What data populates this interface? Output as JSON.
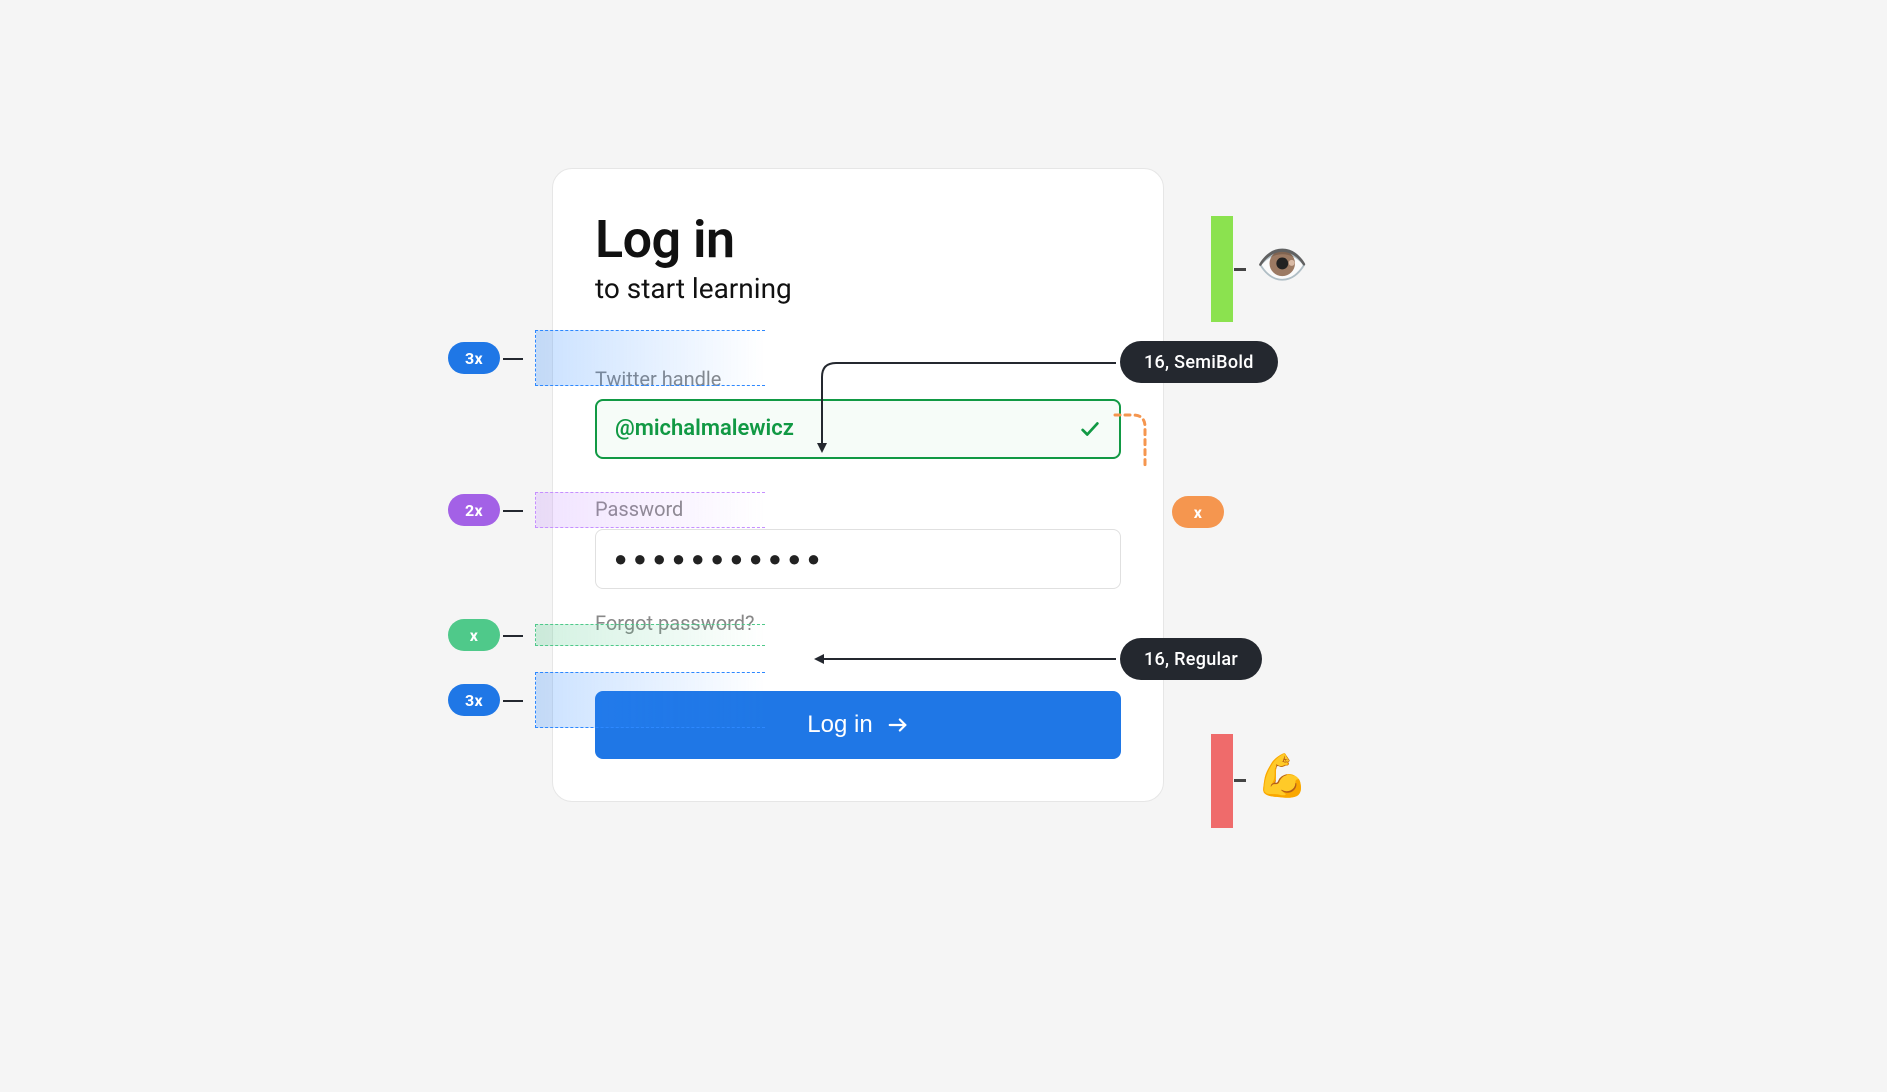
{
  "card": {
    "title": "Log in",
    "subtitle": "to start learning",
    "field_handle_label": "Twitter handle",
    "field_handle_value": "@michalmalewicz",
    "field_password_label": "Password",
    "field_password_masked": "●●●●●●●●●●●",
    "forgot": "Forgot password?",
    "button": "Log in"
  },
  "spacing_badges": {
    "slot_a": "3x",
    "slot_b": "2x",
    "slot_c": "x",
    "slot_d": "3x"
  },
  "typo_callouts": {
    "handle": "16,  SemiBold",
    "forgot": "16, Regular"
  },
  "error_badge": "x",
  "side_icons": {
    "top": "👁️",
    "bottom": "💪"
  },
  "colors": {
    "blue": "#1f77e6",
    "purple": "#a361e6",
    "green": "#4fc98a",
    "orange": "#f5964f",
    "dark": "#24282f",
    "bar_green": "#8be24f",
    "bar_red": "#ef6b6b",
    "valid_green": "#119944"
  }
}
